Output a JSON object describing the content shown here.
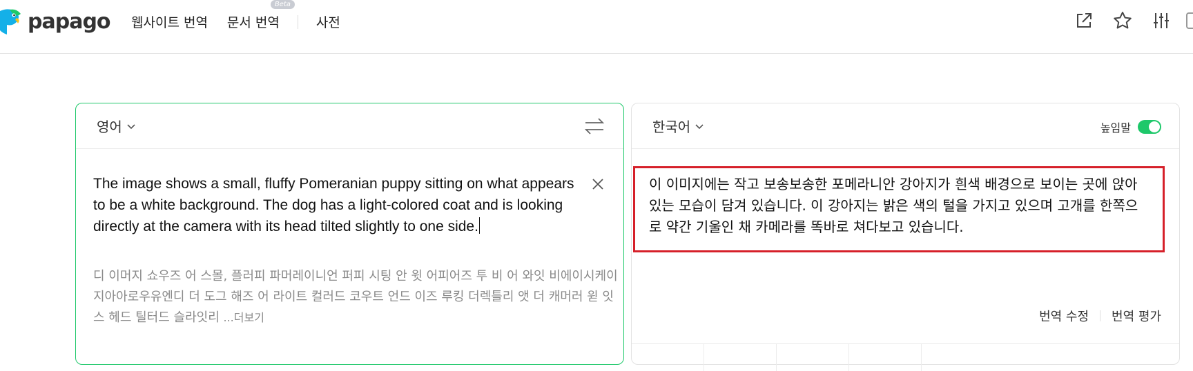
{
  "brand": {
    "name": "papago"
  },
  "nav": {
    "website_translate": "웹사이트 번역",
    "document_translate": "문서 번역",
    "beta_badge": "Beta",
    "dictionary": "사전"
  },
  "top_icons": [
    "share-icon",
    "star-icon",
    "settings-sliders-icon"
  ],
  "source": {
    "language": "영어",
    "text": "The image shows a small, fluffy Pomeranian puppy sitting on what appears to be a white background. The dog has a light-colored coat and is looking directly at the camera with its head tilted slightly to one side.",
    "pronunciation": "디 이머지 쇼우즈 어 스몰, 플러피 파머레이니언 퍼피 시팅 안 윗 어피어즈 투 비 어 와잇 비에이시케이지아아로우유엔디 더 도그 해즈 어 라이트 컬러드 코우트 언드 이즈 루킹 더렉틀리 앳 더 캐머러 윋 잇스 헤드 틸터드 슬라잇리",
    "more_label": "...더보기"
  },
  "target": {
    "language": "한국어",
    "honorific_label": "높임말",
    "honorific_on": true,
    "text": "이 이미지에는 작고 보송보송한 포메라니안 강아지가 흰색 배경으로 보이는 곳에 앉아 있는 모습이 담겨 있습니다. 이 강아지는 밝은 색의 털을 가지고 있으며 고개를 한쪽으로 약간 기울인 채 카메라를 똑바로 쳐다보고 있습니다.",
    "edit_label": "번역 수정",
    "rate_label": "번역 평가"
  },
  "colors": {
    "accent": "#1ec86a",
    "highlight_border": "#d6202a"
  }
}
